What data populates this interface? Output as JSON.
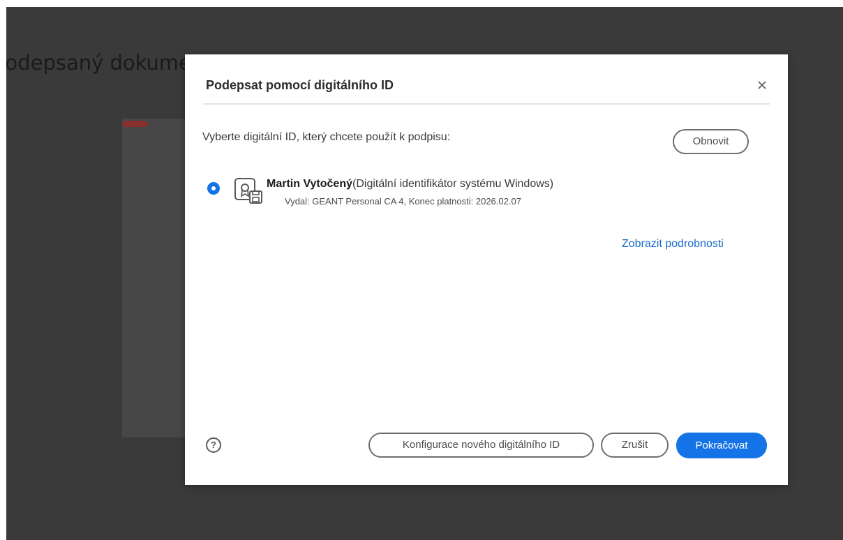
{
  "background": {
    "document_title": "Podepsaný dokument",
    "colors": {
      "backdrop": "#3a3a3a",
      "page": "#474747"
    }
  },
  "dialog": {
    "title": "Podepsat pomocí digitálního ID",
    "close_icon": "close-icon",
    "prompt": "Vyberte digitální ID, který chcete použít k podpisu:",
    "refresh_label": "Obnovit",
    "digital_ids": [
      {
        "selected": true,
        "name": "Martin Vytočený",
        "type": "(Digitální identifikátor systému Windows)",
        "details": "Vydal: GEANT Personal CA 4, Konec platnosti: 2026.02.07",
        "icon": "certificate-icon"
      }
    ],
    "details_link": "Zobrazit podrobnosti",
    "help_icon": "help-icon",
    "help_glyph": "?",
    "buttons": {
      "configure": "Konfigurace nového digitálního ID",
      "cancel": "Zrušit",
      "continue": "Pokračovat"
    },
    "colors": {
      "accent": "#1473e6",
      "link": "#1b6ac9"
    }
  }
}
